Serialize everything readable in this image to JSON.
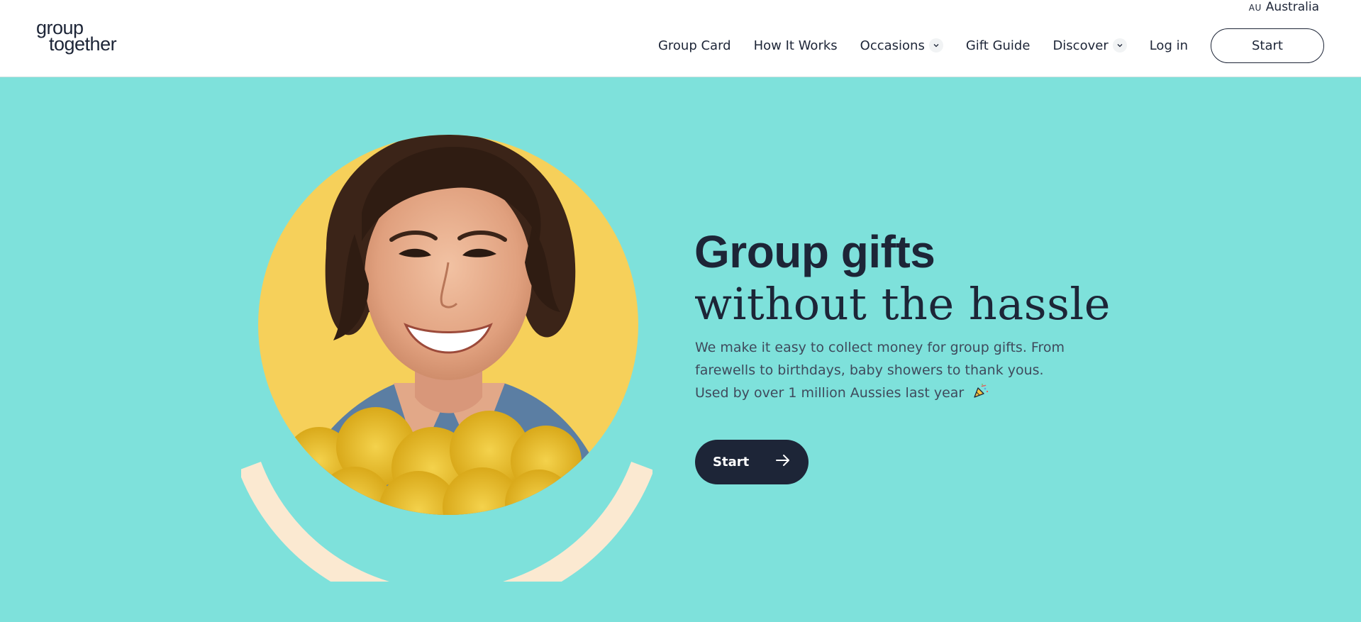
{
  "logo": {
    "line1": "group",
    "line2": "together"
  },
  "region": {
    "code": "AU",
    "label": "Australia"
  },
  "nav": {
    "items": [
      {
        "label": "Group Card"
      },
      {
        "label": "How It Works"
      },
      {
        "label": "Occasions"
      },
      {
        "label": "Gift Guide"
      },
      {
        "label": "Discover"
      },
      {
        "label": "Log in"
      }
    ],
    "start_label": "Start"
  },
  "hero": {
    "title_line1": "Group gifts",
    "title_line2": "without the hassle",
    "description_lines": [
      "We make it easy to collect money for group gifts. From",
      "farewells to birthdays, baby showers to thank yous.",
      "Used by over 1 million Aussies last year"
    ],
    "cta_label": "Start"
  },
  "colors": {
    "background": "#7ee1db",
    "navy": "#1d2537",
    "sun": "#f6d05a",
    "arc": "#fbe9d1"
  },
  "icons": {
    "dropdown": "chevron-down-icon",
    "cta": "arrow-right-icon",
    "emoji": "party-popper-icon"
  }
}
